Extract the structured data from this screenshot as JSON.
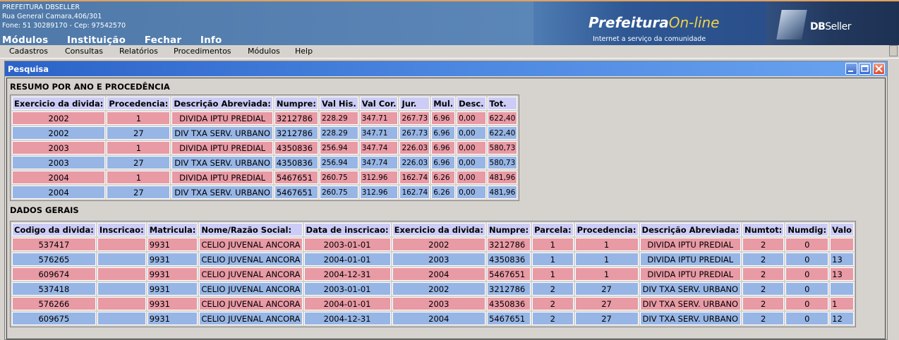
{
  "header": {
    "org_name": "PREFEITURA DBSELLER",
    "address": "Rua General Camara,406/301",
    "phone": "Fone: 51 30289170  -  Cep: 97542570",
    "top_menu": [
      "Módulos",
      "Instituição",
      "Fechar",
      "Info"
    ],
    "pref_logo_main": "Prefeitura",
    "pref_logo_accent": "On-line",
    "pref_slogan": "Internet a serviço da comunidade",
    "db_logo_bold": "DB",
    "db_logo_rest": "Seller"
  },
  "app_menu": [
    "Cadastros",
    "Consultas",
    "Relatórios",
    "Procedimentos",
    "Módulos",
    "Help"
  ],
  "dialog": {
    "title": "Pesquisa",
    "section1_title": "RESUMO POR ANO E PROCEDÊNCIA",
    "section2_title": "DADOS GERAIS"
  },
  "resumo": {
    "headers": [
      "Exercicio da divida:",
      "Procedencia:",
      "Descrição Abreviada:",
      "Numpre:",
      "Val His.",
      "Val Cor.",
      "Jur.",
      "Mul.",
      "Desc.",
      "Tot."
    ],
    "rows": [
      [
        "2002",
        "1",
        "DIVIDA IPTU PREDIAL",
        "3212786",
        "228.29",
        "347.71",
        "267.73",
        "6.96",
        "0,00",
        "622,40"
      ],
      [
        "2002",
        "27",
        "DIV TXA SERV. URBANO",
        "3212786",
        "228.29",
        "347.71",
        "267.73",
        "6.96",
        "0,00",
        "622,40"
      ],
      [
        "2003",
        "1",
        "DIVIDA IPTU PREDIAL",
        "4350836",
        "256.94",
        "347.74",
        "226.03",
        "6.96",
        "0,00",
        "580,73"
      ],
      [
        "2003",
        "27",
        "DIV TXA SERV. URBANO",
        "4350836",
        "256.94",
        "347.74",
        "226.03",
        "6.96",
        "0,00",
        "580,73"
      ],
      [
        "2004",
        "1",
        "DIVIDA IPTU PREDIAL",
        "5467651",
        "260.75",
        "312.96",
        "162.74",
        "6.26",
        "0,00",
        "481,96"
      ],
      [
        "2004",
        "27",
        "DIV TXA SERV. URBANO",
        "5467651",
        "260.75",
        "312.96",
        "162.74",
        "6.26",
        "0,00",
        "481,96"
      ]
    ]
  },
  "dados": {
    "headers": [
      "Codigo da divida:",
      "Inscricao:",
      "Matricula:",
      "Nome/Razão Social:",
      "Data de inscricao:",
      "Exercicio da divida:",
      "Numpre:",
      "Parcela:",
      "Procedencia:",
      "Descrição Abreviada:",
      "Numtot:",
      "Numdig:",
      "Valo"
    ],
    "rows": [
      [
        "537417",
        "",
        "9931",
        "CELIO JUVENAL ANCORA",
        "2003-01-01",
        "2002",
        "3212786",
        "1",
        "1",
        "DIVIDA IPTU PREDIAL",
        "2",
        "0",
        ""
      ],
      [
        "576265",
        "",
        "9931",
        "CELIO JUVENAL ANCORA",
        "2004-01-01",
        "2003",
        "4350836",
        "1",
        "1",
        "DIVIDA IPTU PREDIAL",
        "2",
        "0",
        "13"
      ],
      [
        "609674",
        "",
        "9931",
        "CELIO JUVENAL ANCORA",
        "2004-12-31",
        "2004",
        "5467651",
        "1",
        "1",
        "DIVIDA IPTU PREDIAL",
        "2",
        "0",
        "13"
      ],
      [
        "537418",
        "",
        "9931",
        "CELIO JUVENAL ANCORA",
        "2003-01-01",
        "2002",
        "3212786",
        "2",
        "27",
        "DIV TXA SERV. URBANO",
        "2",
        "0",
        ""
      ],
      [
        "576266",
        "",
        "9931",
        "CELIO JUVENAL ANCORA",
        "2004-01-01",
        "2003",
        "4350836",
        "2",
        "27",
        "DIV TXA SERV. URBANO",
        "2",
        "0",
        "1"
      ],
      [
        "609675",
        "",
        "9931",
        "CELIO JUVENAL ANCORA",
        "2004-12-31",
        "2004",
        "5467651",
        "2",
        "27",
        "DIV TXA SERV. URBANO",
        "2",
        "0",
        "12"
      ]
    ]
  },
  "colors": {
    "row_pink": "#e89aa5",
    "row_blue": "#97b6e6",
    "header_bg": "#ccccf6",
    "title_blue": "#2b63c8"
  }
}
